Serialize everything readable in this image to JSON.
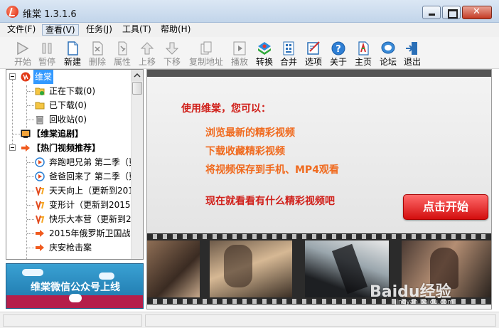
{
  "window": {
    "title": "维棠 1.3.1.6"
  },
  "menu": [
    {
      "label": "文件(F)",
      "active": false
    },
    {
      "label": "查看(V)",
      "active": true
    },
    {
      "label": "任务(J)",
      "active": false
    },
    {
      "label": "工具(T)",
      "active": false
    },
    {
      "label": "帮助(H)",
      "active": false
    }
  ],
  "toolbar": [
    {
      "label": "开始",
      "icon": "play-arrow-icon",
      "enabled": false
    },
    {
      "label": "暂停",
      "icon": "pause-icon",
      "enabled": false
    },
    {
      "label": "新建",
      "icon": "new-document-icon",
      "enabled": true
    },
    {
      "label": "删除",
      "icon": "delete-icon",
      "enabled": false
    },
    {
      "label": "属性",
      "icon": "properties-icon",
      "enabled": false
    },
    {
      "label": "上移",
      "icon": "move-up-icon",
      "enabled": false
    },
    {
      "label": "下移",
      "icon": "move-down-icon",
      "enabled": false
    },
    {
      "label": "复制地址",
      "icon": "copy-address-icon",
      "enabled": false
    },
    {
      "label": "播放",
      "icon": "play-media-icon",
      "enabled": false
    },
    {
      "label": "转换",
      "icon": "convert-icon",
      "enabled": true
    },
    {
      "label": "合并",
      "icon": "merge-icon",
      "enabled": true
    },
    {
      "label": "选项",
      "icon": "options-icon",
      "enabled": true
    },
    {
      "label": "关于",
      "icon": "about-icon",
      "enabled": true
    },
    {
      "label": "主页",
      "icon": "homepage-icon",
      "enabled": true
    },
    {
      "label": "论坛",
      "icon": "forum-icon",
      "enabled": true
    },
    {
      "label": "退出",
      "icon": "exit-icon",
      "enabled": true
    }
  ],
  "tree": {
    "root": {
      "label": "维棠",
      "icon": "weitang-logo-icon",
      "selected": true
    },
    "items": [
      {
        "label": "正在下载(0)",
        "icon": "downloading-folder-icon"
      },
      {
        "label": "已下载(0)",
        "icon": "downloaded-folder-icon"
      },
      {
        "label": "回收站(0)",
        "icon": "recycle-bin-icon"
      }
    ],
    "drama_section": {
      "label": "【维棠追剧】",
      "icon": "tv-icon"
    },
    "hot_section": {
      "label": "【热门视频推荐】",
      "icon": "arrow-right-icon"
    },
    "hot_items": [
      {
        "label": "奔跑吧兄弟 第二季（更",
        "icon": "play-circle-icon"
      },
      {
        "label": "爸爸回来了 第二季（更",
        "icon": "play-circle-icon"
      },
      {
        "label": "天天向上（更新到201",
        "icon": "channel-logo-icon"
      },
      {
        "label": "变形计（更新到2015-",
        "icon": "channel-logo-icon"
      },
      {
        "label": "快乐大本营（更新到2",
        "icon": "channel-logo-icon"
      },
      {
        "label": "2015年俄罗斯卫国战",
        "icon": "arrow-right-icon"
      },
      {
        "label": "庆安枪击案",
        "icon": "arrow-right-icon"
      }
    ]
  },
  "banner": {
    "text": "维棠微信公众号上线"
  },
  "promo": {
    "title": "使用维棠，您可以：",
    "lines": [
      "浏览最新的精彩视频",
      "下载收藏精彩视频",
      "将视频保存到手机、MP4观看"
    ],
    "cta_text": "现在就看看有什么精彩视频吧",
    "start_button": "点击开始"
  },
  "colors": {
    "promo_title": "#d0201a",
    "promo_lines": "#f06a1e",
    "start_button": "#d30e0e",
    "selection": "#3399ff"
  },
  "watermark": {
    "text": "Baidu经验",
    "sub": "jingyan.baidu.com"
  }
}
